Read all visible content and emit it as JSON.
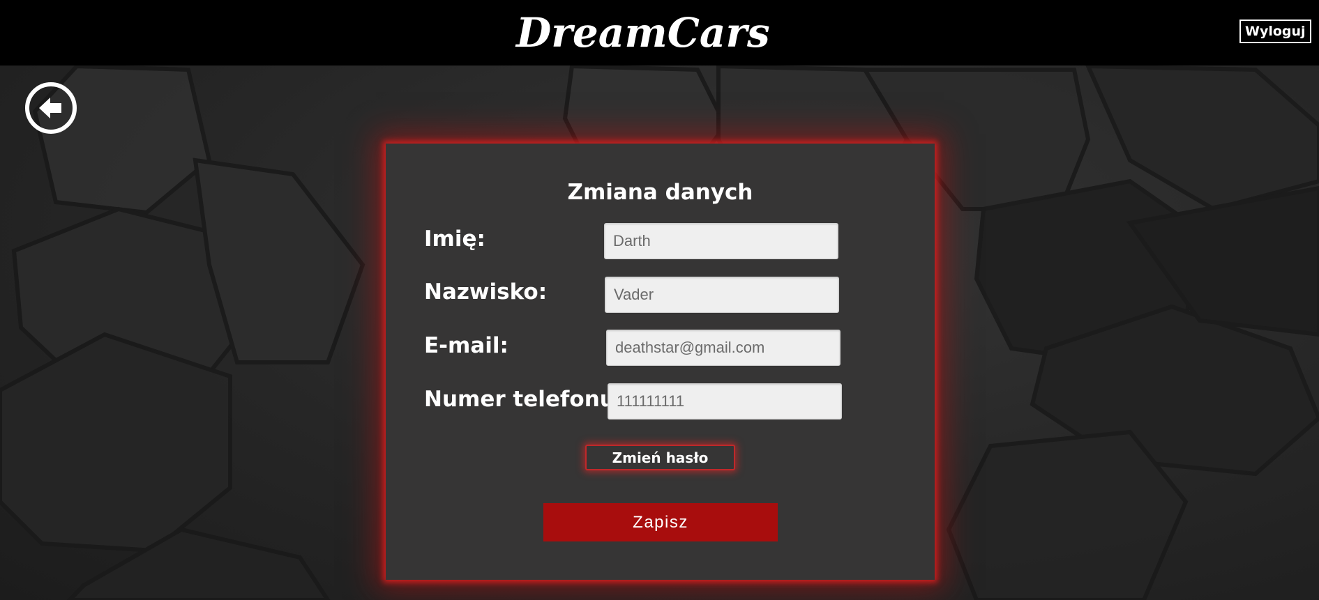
{
  "header": {
    "logo": "DreamCars",
    "logout_label": "Wyloguj"
  },
  "form": {
    "title": "Zmiana danych",
    "fields": [
      {
        "label": "Imię:",
        "value": "Darth"
      },
      {
        "label": "Nazwisko:",
        "value": "Vader"
      },
      {
        "label": "E-mail:",
        "value": "deathstar@gmail.com"
      },
      {
        "label": "Numer telefonu:",
        "value": "111111111"
      }
    ],
    "change_password_label": "Zmień hasło",
    "save_label": "Zapisz"
  },
  "icons": {
    "back": "back-arrow-icon"
  },
  "colors": {
    "accent": "#a80d0d",
    "glow": "#c0282a",
    "panel": "#363535",
    "header": "#000000"
  }
}
